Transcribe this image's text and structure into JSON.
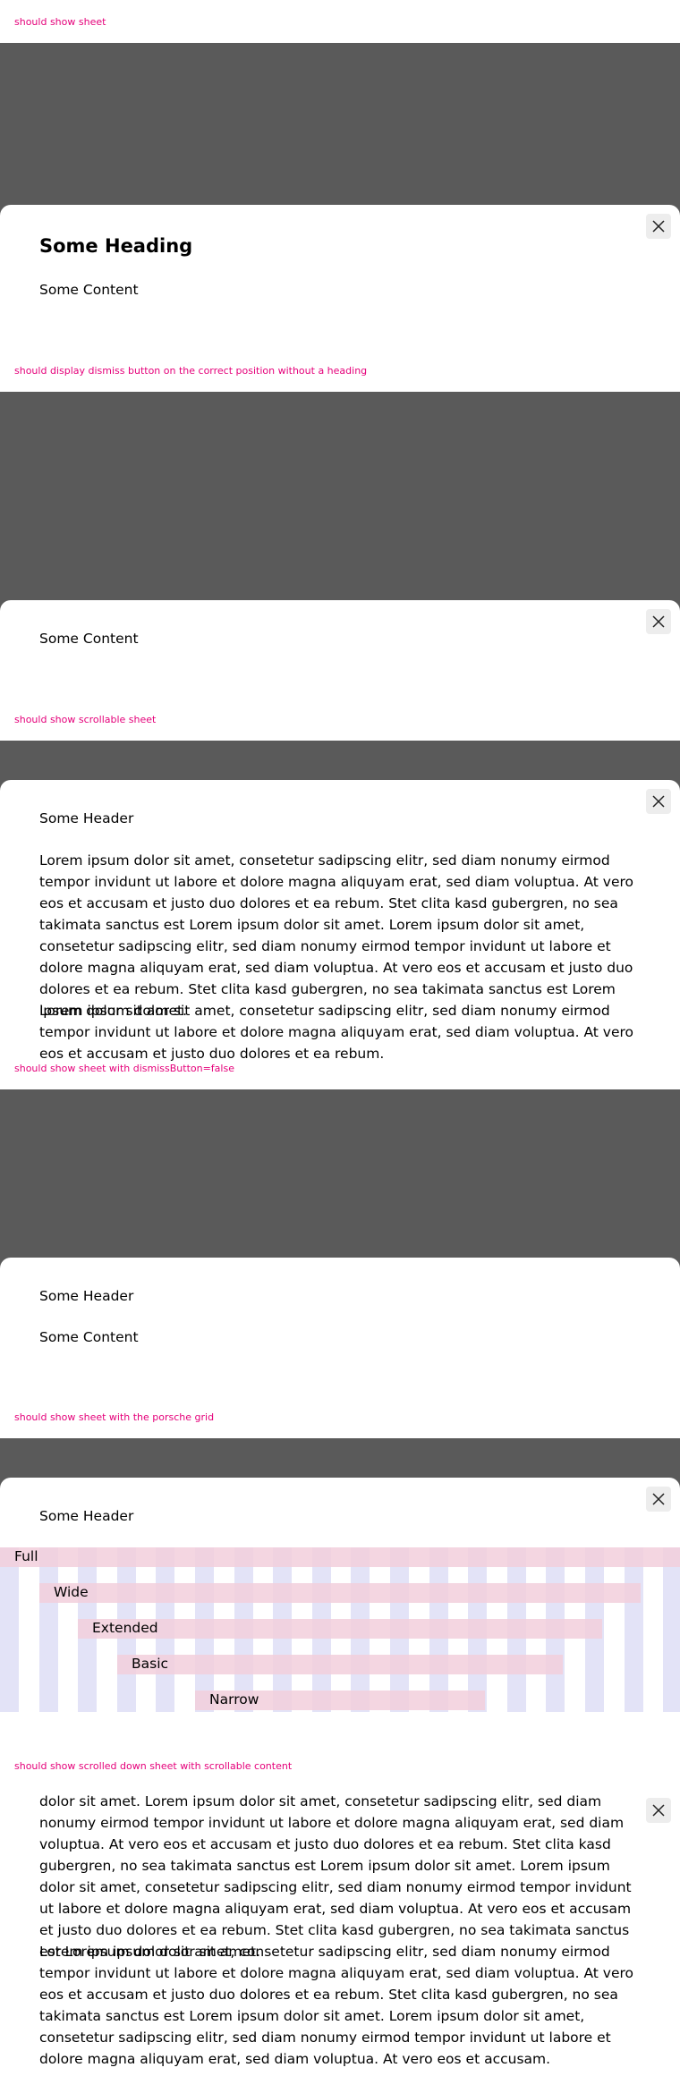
{
  "sections": [
    {
      "label": "should show sheet",
      "heading": "Some Heading",
      "content": "Some Content"
    },
    {
      "label": "should display dismiss button on the correct position without a heading",
      "content": "Some Content"
    },
    {
      "label": "should show scrollable sheet",
      "header": "Some Header"
    },
    {
      "label": "should show sheet with dismissButton=false",
      "header": "Some Header",
      "content": "Some Content"
    },
    {
      "label": "should show sheet with the porsche grid",
      "header": "Some Header",
      "grid_labels": [
        "Full",
        "Wide",
        "Extended",
        "Basic",
        "Narrow"
      ]
    },
    {
      "label": "should show scrolled down sheet with scrollable content"
    }
  ],
  "lorem": {
    "para1": "Lorem ipsum dolor sit amet, consetetur sadipscing elitr, sed diam nonumy eirmod tempor invidunt ut labore et dolore magna aliquyam erat, sed diam voluptua. At vero eos et accusam et justo duo dolores et ea rebum. Stet clita kasd gubergren, no sea takimata sanctus est Lorem ipsum dolor sit amet. Lorem ipsum dolor sit amet, consetetur sadipscing elitr, sed diam nonumy eirmod tempor invidunt ut labore et dolore magna aliquyam erat, sed diam voluptua. At vero eos et accusam et justo duo dolores et ea rebum. Stet clita kasd gubergren, no sea takimata sanctus est Lorem ipsum dolor sit amet.",
    "para2": "Lorem ipsum dolor sit amet, consetetur sadipscing elitr, sed diam nonumy eirmod tempor invidunt ut labore et dolore magna aliquyam erat, sed diam voluptua. At vero eos et accusam et justo duo dolores et ea rebum.",
    "scrolled1": "dolor sit amet. Lorem ipsum dolor sit amet, consetetur sadipscing elitr, sed diam nonumy eirmod tempor invidunt ut labore et dolore magna aliquyam erat, sed diam voluptua. At vero eos et accusam et justo duo dolores et ea rebum. Stet clita kasd gubergren, no sea takimata sanctus est Lorem ipsum dolor sit amet. Lorem ipsum dolor sit amet, consetetur sadipscing elitr, sed diam nonumy eirmod tempor invidunt ut labore et dolore magna aliquyam erat, sed diam voluptua. At vero eos et accusam et justo duo dolores et ea rebum. Stet clita kasd gubergren, no sea takimata sanctus est Lorem ipsum dolor sit amet.",
    "scrolled2": "Lorem ipsum dolor sit amet, consetetur sadipscing elitr, sed diam nonumy eirmod tempor invidunt ut labore et dolore magna aliquyam erat, sed diam voluptua. At vero eos et accusam et justo duo dolores et ea rebum. Stet clita kasd gubergren, no sea takimata sanctus est Lorem ipsum dolor sit amet. Lorem ipsum dolor sit amet, consetetur sadipscing elitr, sed diam nonumy eirmod tempor invidunt ut labore et dolore magna aliquyam erat, sed diam voluptua. At vero eos et accusam."
  },
  "icons": {
    "dismiss": "close-icon"
  },
  "colors": {
    "label": "#e5007a",
    "backdrop": "#5a5a5a",
    "grid_column": "#e3e3f7",
    "grid_band": "#f2cfdc"
  }
}
